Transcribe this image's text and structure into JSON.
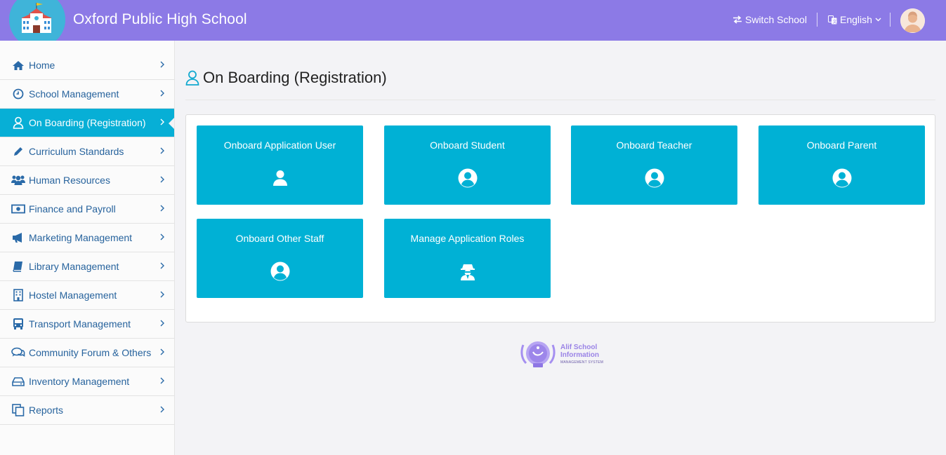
{
  "header": {
    "title": "Oxford Public High School",
    "switch_school": "Switch School",
    "language": "English",
    "color": "#8c7ae6"
  },
  "sidebar": {
    "items": [
      {
        "label": "Home",
        "icon": "home-icon"
      },
      {
        "label": "School Management",
        "icon": "clock-icon"
      },
      {
        "label": "On Boarding (Registration)",
        "icon": "user-outline-icon",
        "active": true
      },
      {
        "label": "Curriculum Standards",
        "icon": "pencil-icon"
      },
      {
        "label": "Human Resources",
        "icon": "users-icon"
      },
      {
        "label": "Finance and Payroll",
        "icon": "money-icon"
      },
      {
        "label": "Marketing Management",
        "icon": "bullhorn-icon"
      },
      {
        "label": "Library Management",
        "icon": "book-icon"
      },
      {
        "label": "Hostel Management",
        "icon": "building-icon"
      },
      {
        "label": "Transport Management",
        "icon": "bus-icon"
      },
      {
        "label": "Community Forum & Others",
        "icon": "comments-icon"
      },
      {
        "label": "Inventory Management",
        "icon": "hdd-icon"
      },
      {
        "label": "Reports",
        "icon": "copy-icon"
      }
    ],
    "active_color": "#07afd6"
  },
  "main": {
    "title": "On Boarding (Registration)",
    "tiles": [
      {
        "label": "Onboard Application User",
        "icon": "user-icon"
      },
      {
        "label": "Onboard Student",
        "icon": "user-circle-icon"
      },
      {
        "label": "Onboard Teacher",
        "icon": "user-circle-icon"
      },
      {
        "label": "Onboard Parent",
        "icon": "user-circle-icon"
      },
      {
        "label": "Onboard Other Staff",
        "icon": "user-circle-icon"
      },
      {
        "label": "Manage Application Roles",
        "icon": "user-secret-icon"
      }
    ],
    "tile_color": "#00b1d5"
  },
  "footer": {
    "brand_line1": "Alif School",
    "brand_line2": "Information",
    "brand_line3": "MANAGEMENT SYSTEM"
  }
}
